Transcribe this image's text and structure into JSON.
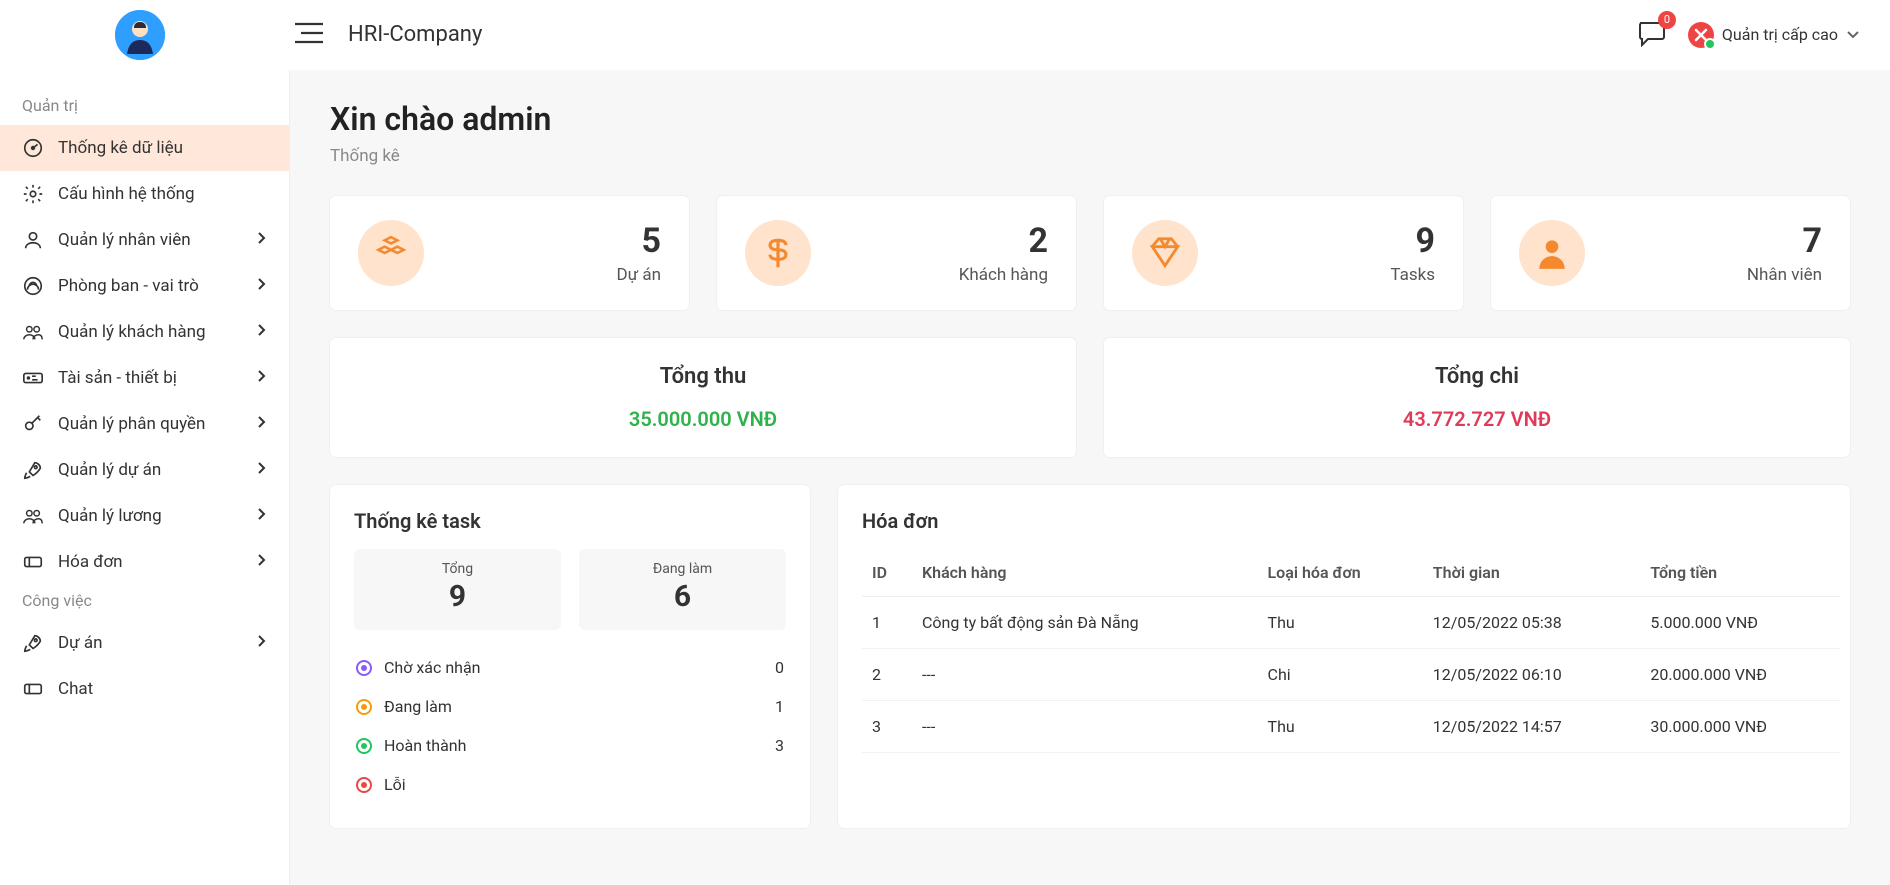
{
  "header": {
    "app_title": "HRI-Company",
    "chat_badge": "0",
    "user_role": "Quản trị cấp cao"
  },
  "sidebar": {
    "section1_label": "Quản trị",
    "section2_label": "Công việc",
    "items1": [
      {
        "label": "Thống kê dữ liệu",
        "expandable": false,
        "active": true,
        "icon": "gauge-icon"
      },
      {
        "label": "Cấu hình hệ thống",
        "expandable": false,
        "active": false,
        "icon": "gear-icon"
      },
      {
        "label": "Quản lý nhân viên",
        "expandable": true,
        "active": false,
        "icon": "user-icon"
      },
      {
        "label": "Phòng ban - vai trò",
        "expandable": true,
        "active": false,
        "icon": "building-icon"
      },
      {
        "label": "Quản lý khách hàng",
        "expandable": true,
        "active": false,
        "icon": "users-icon"
      },
      {
        "label": "Tài sản - thiết bị",
        "expandable": true,
        "active": false,
        "icon": "asset-icon"
      },
      {
        "label": "Quản lý phân quyền",
        "expandable": true,
        "active": false,
        "icon": "key-icon"
      },
      {
        "label": "Quản lý dự án",
        "expandable": true,
        "active": false,
        "icon": "rocket-icon"
      },
      {
        "label": "Quản lý lương",
        "expandable": true,
        "active": false,
        "icon": "users-icon"
      },
      {
        "label": "Hóa đơn",
        "expandable": true,
        "active": false,
        "icon": "ticket-icon"
      }
    ],
    "items2": [
      {
        "label": "Dự án",
        "expandable": true,
        "active": false,
        "icon": "rocket-icon"
      },
      {
        "label": "Chat",
        "expandable": false,
        "active": false,
        "icon": "ticket-icon"
      }
    ]
  },
  "page": {
    "title": "Xin chào admin",
    "subtitle": "Thống kê"
  },
  "stats": [
    {
      "value": "5",
      "label": "Dự án",
      "icon": "boxes-icon"
    },
    {
      "value": "2",
      "label": "Khách hàng",
      "icon": "dollar-icon"
    },
    {
      "value": "9",
      "label": "Tasks",
      "icon": "diamond-icon"
    },
    {
      "value": "7",
      "label": "Nhân viên",
      "icon": "person-icon"
    }
  ],
  "totals": {
    "income_label": "Tổng thu",
    "income_value": "35.000.000 VNĐ",
    "expense_label": "Tổng chi",
    "expense_value": "43.772.727 VNĐ"
  },
  "task_stats": {
    "title": "Thống kê task",
    "total_label": "Tổng",
    "total_value": "9",
    "doing_label": "Đang làm",
    "doing_value": "6",
    "rows": [
      {
        "label": "Chờ xác nhận",
        "count": "0",
        "color": "purple"
      },
      {
        "label": "Đang làm",
        "count": "1",
        "color": "orange"
      },
      {
        "label": "Hoàn thành",
        "count": "3",
        "color": "green"
      },
      {
        "label": "Lỗi",
        "count": "",
        "color": "redc"
      }
    ]
  },
  "invoices": {
    "title": "Hóa đơn",
    "columns": [
      "ID",
      "Khách hàng",
      "Loại hóa đơn",
      "Thời gian",
      "Tổng tiền"
    ],
    "rows": [
      {
        "id": "1",
        "customer": "Công ty bất động sản Đà Nẵng",
        "type": "Thu",
        "time": "12/05/2022 05:38",
        "total": "5.000.000 VNĐ"
      },
      {
        "id": "2",
        "customer": "---",
        "type": "Chi",
        "time": "12/05/2022 06:10",
        "total": "20.000.000 VNĐ"
      },
      {
        "id": "3",
        "customer": "---",
        "type": "Thu",
        "time": "12/05/2022 14:57",
        "total": "30.000.000 VNĐ"
      }
    ]
  }
}
